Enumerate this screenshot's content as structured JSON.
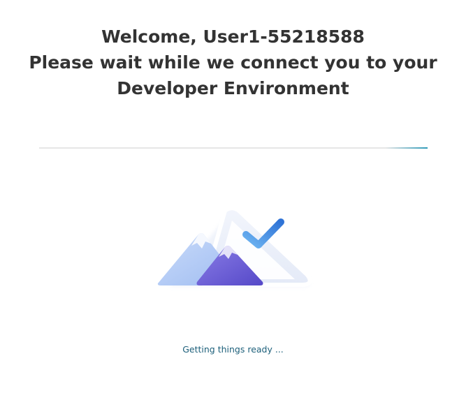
{
  "header": {
    "line1": "Welcome, User1-55218588",
    "line2": "Please wait while we connect you to your",
    "line3": "Developer Environment"
  },
  "progress": {
    "indeterminate": true,
    "accent_color": "#2e9ab8"
  },
  "illustration": {
    "icon": "mountains-checkmark-icon",
    "colors": {
      "back_mountain": "#b4cdf6",
      "front_mountain": "#6f62d8",
      "checkmark": "#3f86dc",
      "frame": "#eef2fb"
    }
  },
  "status": {
    "text": "Getting things ready ..."
  }
}
